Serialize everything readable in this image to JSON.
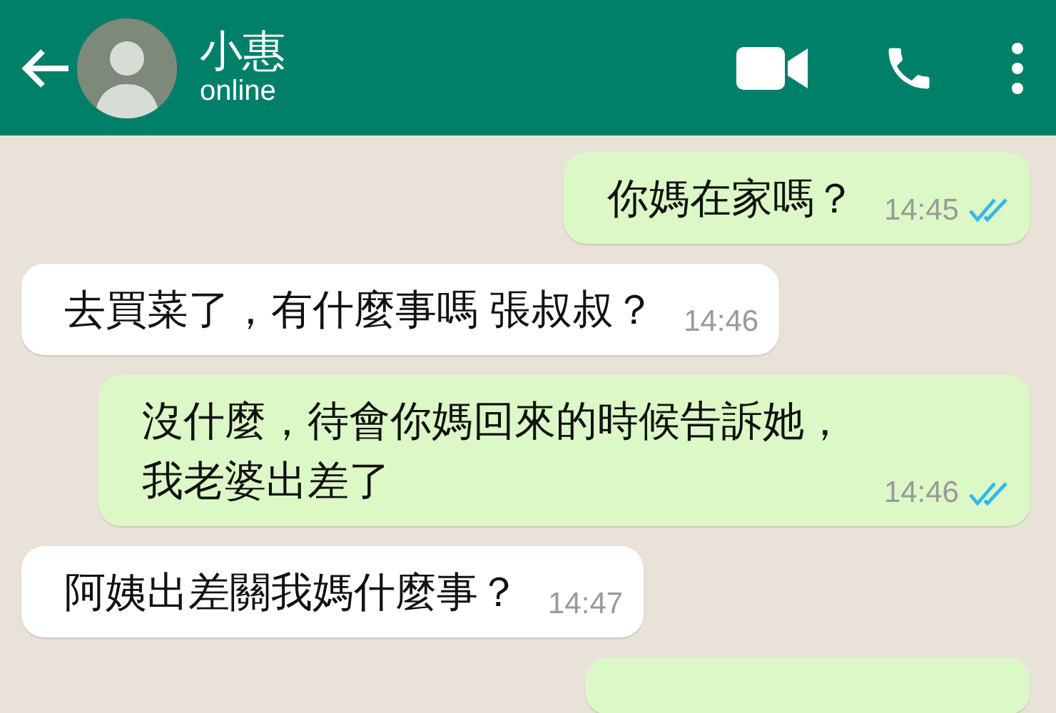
{
  "header": {
    "contact_name": "小惠",
    "status": "online"
  },
  "messages": [
    {
      "kind": "out",
      "text": "你媽在家嗎？",
      "time": "14:45",
      "read": true
    },
    {
      "kind": "in",
      "text": "去買菜了，有什麼事嗎 張叔叔？",
      "time": "14:46"
    },
    {
      "kind": "out",
      "text": "沒什麼，待會你媽回來的時候告訴她，我老婆出差了",
      "time": "14:46",
      "read": true
    },
    {
      "kind": "in",
      "text": "阿姨出差關我媽什麼事？",
      "time": "14:47"
    },
    {
      "kind": "out"
    }
  ]
}
